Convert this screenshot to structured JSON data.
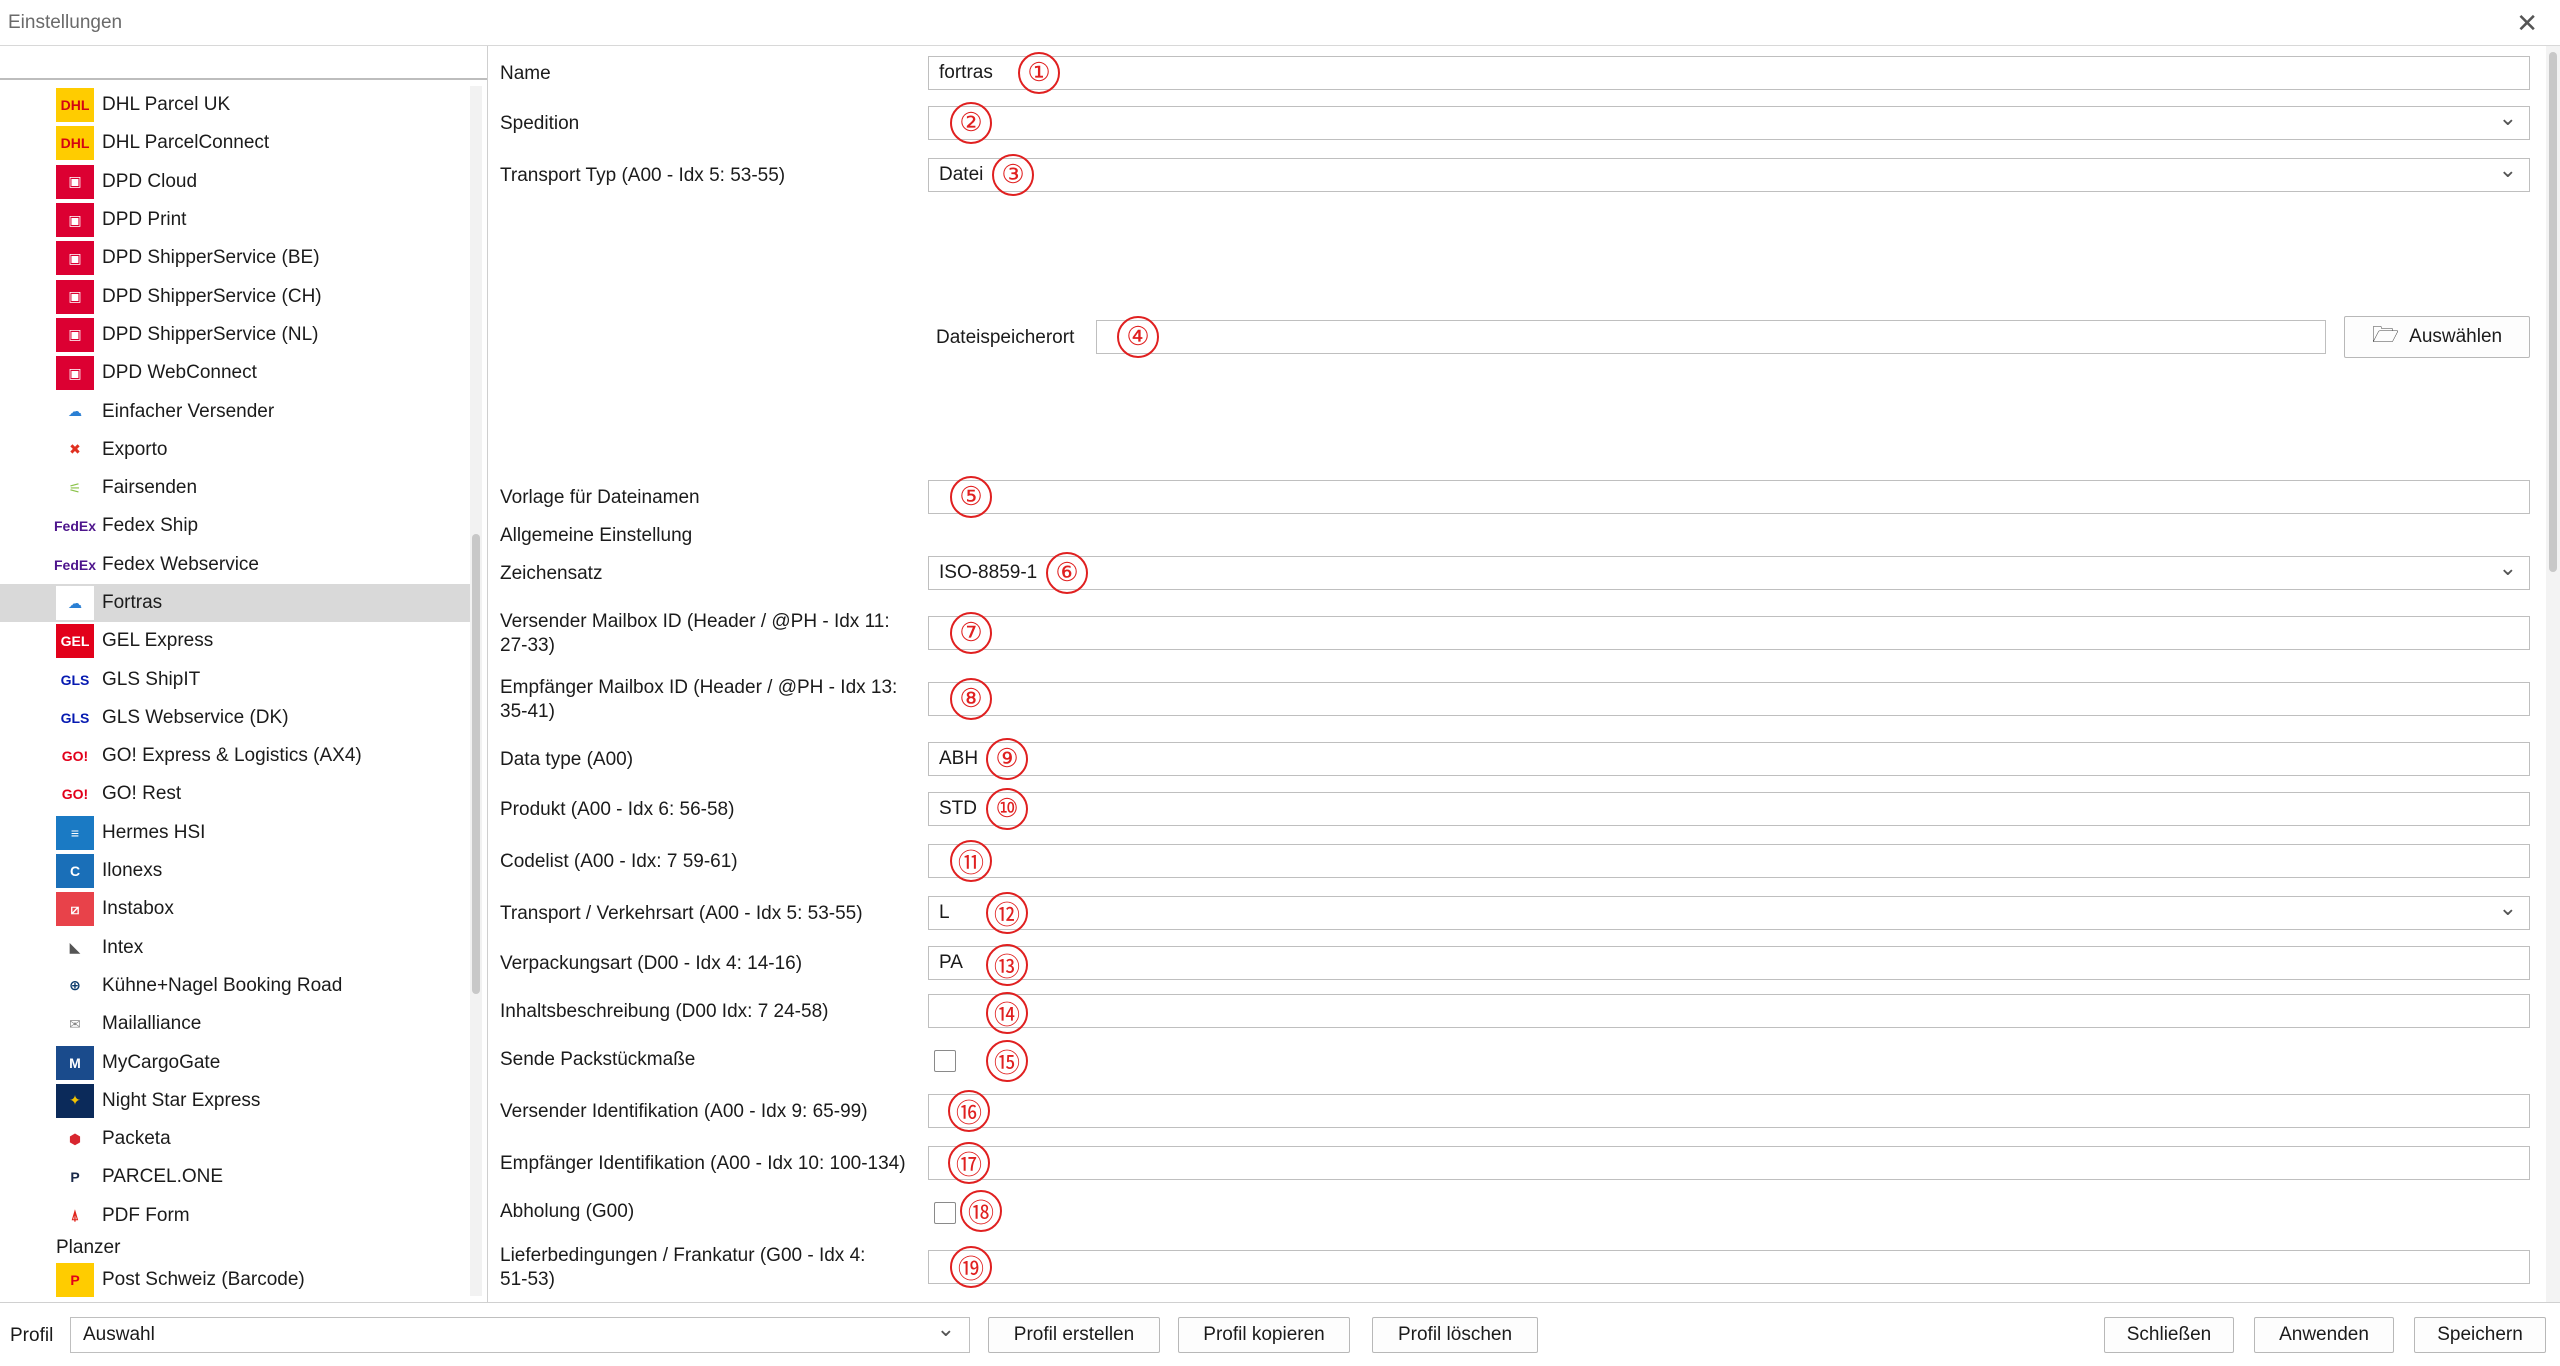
{
  "window": {
    "title": "Einstellungen",
    "close_glyph": "✕"
  },
  "sidebar": {
    "items": [
      {
        "label": "DHL Parcel UK",
        "icon": "dhl-icon",
        "color": "#ffcc00",
        "fg": "#d40511",
        "glyph": "DHL"
      },
      {
        "label": "DHL ParcelConnect",
        "icon": "dhl-icon",
        "color": "#ffcc00",
        "fg": "#d40511",
        "glyph": "DHL"
      },
      {
        "label": "DPD Cloud",
        "icon": "dpd-icon",
        "color": "#dc0032",
        "fg": "#ffffff",
        "glyph": "▣"
      },
      {
        "label": "DPD Print",
        "icon": "dpd-icon",
        "color": "#dc0032",
        "fg": "#ffffff",
        "glyph": "▣"
      },
      {
        "label": "DPD ShipperService (BE)",
        "icon": "dpd-icon",
        "color": "#dc0032",
        "fg": "#ffffff",
        "glyph": "▣"
      },
      {
        "label": "DPD ShipperService (CH)",
        "icon": "dpd-icon",
        "color": "#dc0032",
        "fg": "#ffffff",
        "glyph": "▣"
      },
      {
        "label": "DPD ShipperService (NL)",
        "icon": "dpd-icon",
        "color": "#dc0032",
        "fg": "#ffffff",
        "glyph": "▣"
      },
      {
        "label": "DPD WebConnect",
        "icon": "dpd-icon",
        "color": "#dc0032",
        "fg": "#ffffff",
        "glyph": "▣"
      },
      {
        "label": "Einfacher Versender",
        "icon": "cloud-icon",
        "color": "#ffffff",
        "fg": "#2a7fd4",
        "glyph": "☁"
      },
      {
        "label": "Exporto",
        "icon": "exporto-icon",
        "color": "#ffffff",
        "fg": "#e03020",
        "glyph": "✖"
      },
      {
        "label": "Fairsenden",
        "icon": "fairsenden-icon",
        "color": "#ffffff",
        "fg": "#8bc34a",
        "glyph": "⚟"
      },
      {
        "label": "Fedex Ship",
        "icon": "fedex-icon",
        "color": "#ffffff",
        "fg": "#4d148c",
        "glyph": "FedEx"
      },
      {
        "label": "Fedex Webservice",
        "icon": "fedex-icon",
        "color": "#ffffff",
        "fg": "#4d148c",
        "glyph": "FedEx"
      },
      {
        "label": "Fortras",
        "icon": "cloud-icon",
        "color": "#ffffff",
        "fg": "#2a7fd4",
        "glyph": "☁"
      },
      {
        "label": "GEL Express",
        "icon": "gel-icon",
        "color": "#e2001a",
        "fg": "#ffffff",
        "glyph": "GEL"
      },
      {
        "label": "GLS ShipIT",
        "icon": "gls-icon",
        "color": "#ffffff",
        "fg": "#061ab1",
        "glyph": "GLS"
      },
      {
        "label": "GLS Webservice (DK)",
        "icon": "gls-icon",
        "color": "#ffffff",
        "fg": "#061ab1",
        "glyph": "GLS"
      },
      {
        "label": "GO! Express & Logistics (AX4)",
        "icon": "go-icon",
        "color": "#ffffff",
        "fg": "#e2001a",
        "glyph": "GO!"
      },
      {
        "label": "GO! Rest",
        "icon": "go-icon",
        "color": "#ffffff",
        "fg": "#e2001a",
        "glyph": "GO!"
      },
      {
        "label": "Hermes HSI",
        "icon": "hermes-icon",
        "color": "#1a7ac4",
        "fg": "#ffffff",
        "glyph": "≡"
      },
      {
        "label": "Ilonexs",
        "icon": "ilonexs-icon",
        "color": "#1a6fb8",
        "fg": "#ffffff",
        "glyph": "C"
      },
      {
        "label": "Instabox",
        "icon": "instabox-icon",
        "color": "#e8424a",
        "fg": "#ffffff",
        "glyph": "⧄"
      },
      {
        "label": "Intex",
        "icon": "intex-icon",
        "color": "#ffffff",
        "fg": "#555555",
        "glyph": "◣"
      },
      {
        "label": "Kühne+Nagel Booking Road",
        "icon": "kuehne-nagel-icon",
        "color": "#ffffff",
        "fg": "#0a3a6b",
        "glyph": "⊕"
      },
      {
        "label": "Mailalliance",
        "icon": "mail-icon",
        "color": "#ffffff",
        "fg": "#888888",
        "glyph": "✉"
      },
      {
        "label": "MyCargoGate",
        "icon": "mycargogate-icon",
        "color": "#1a4b8c",
        "fg": "#ffffff",
        "glyph": "M"
      },
      {
        "label": "Night Star Express",
        "icon": "night-star-icon",
        "color": "#0b2a5a",
        "fg": "#f2c200",
        "glyph": "✦"
      },
      {
        "label": "Packeta",
        "icon": "packeta-icon",
        "color": "#ffffff",
        "fg": "#d8262f",
        "glyph": "⬢"
      },
      {
        "label": "PARCEL.ONE",
        "icon": "parcel-one-icon",
        "color": "#ffffff",
        "fg": "#1a2a4a",
        "glyph": "P"
      },
      {
        "label": "PDF Form",
        "icon": "pdf-icon",
        "color": "#ffffff",
        "fg": "#e0241b",
        "glyph": "⍋"
      }
    ],
    "group_label": "Planzer",
    "post_item": {
      "label": "Post Schweiz (Barcode)",
      "icon": "post-schweiz-icon",
      "color": "#ffcc00",
      "fg": "#e2001a",
      "glyph": "P"
    }
  },
  "form": {
    "name": {
      "label": "Name",
      "value": "fortras",
      "n": "①"
    },
    "spedition": {
      "label": "Spedition",
      "value": "",
      "n": "②"
    },
    "transport_typ": {
      "label": "Transport Typ (A00 - Idx 5: 53-55)",
      "value": "Datei",
      "n": "③"
    },
    "dateispeicherort": {
      "label": "Dateispeicherort",
      "value": "",
      "n": "④",
      "button": "Auswählen"
    },
    "vorlage": {
      "label": "Vorlage für Dateinamen",
      "value": "",
      "n": "⑤"
    },
    "allgemein": {
      "label": "Allgemeine Einstellung"
    },
    "zeichensatz": {
      "label": "Zeichensatz",
      "value": "ISO-8859-1",
      "n": "⑥"
    },
    "versender_mailbox": {
      "label1": "Versender Mailbox ID (Header / @PH - Idx 11:",
      "label2": "27-33)",
      "value": "",
      "n": "⑦"
    },
    "empfaenger_mailbox": {
      "label1": "Empfänger Mailbox ID (Header / @PH - Idx 13:",
      "label2": "35-41)",
      "value": "",
      "n": "⑧"
    },
    "data_type": {
      "label": "Data type (A00)",
      "value": "ABH",
      "n": "⑨"
    },
    "produkt": {
      "label": "Produkt (A00 - Idx 6: 56-58)",
      "value": "STD",
      "n": "⑩"
    },
    "codelist": {
      "label": "Codelist (A00 - Idx: 7 59-61)",
      "value": "",
      "n": "⑪"
    },
    "verkehrsart": {
      "label": "Transport / Verkehrsart (A00 - Idx 5: 53-55)",
      "value": "L",
      "n": "⑫"
    },
    "verpackungsart": {
      "label": "Verpackungsart (D00 - Idx 4: 14-16)",
      "value": "PA",
      "n": "⑬"
    },
    "inhalt": {
      "label": "Inhaltsbeschreibung (D00 Idx: 7 24-58)",
      "value": "",
      "n": "⑭"
    },
    "packstueck": {
      "label": "Sende Packstückmaße",
      "n": "⑮"
    },
    "versender_ident": {
      "label": "Versender Identifikation (A00 - Idx 9: 65-99)",
      "value": "",
      "n": "⑯"
    },
    "empfaenger_ident": {
      "label": "Empfänger Identifikation (A00 - Idx 10: 100-134)",
      "value": "",
      "n": "⑰"
    },
    "abholung": {
      "label": "Abholung (G00)",
      "n": "⑱"
    },
    "lieferbedingungen": {
      "label1": "Lieferbedingungen / Frankatur (G00 - Idx 4:",
      "label2": "51-53)",
      "value": "",
      "n": "⑲"
    }
  },
  "bottom": {
    "profil_label": "Profil",
    "profil_value": "Auswahl",
    "erstellen": "Profil erstellen",
    "kopieren": "Profil kopieren",
    "loeschen": "Profil löschen",
    "schliessen": "Schließen",
    "anwenden": "Anwenden",
    "speichern": "Speichern"
  }
}
